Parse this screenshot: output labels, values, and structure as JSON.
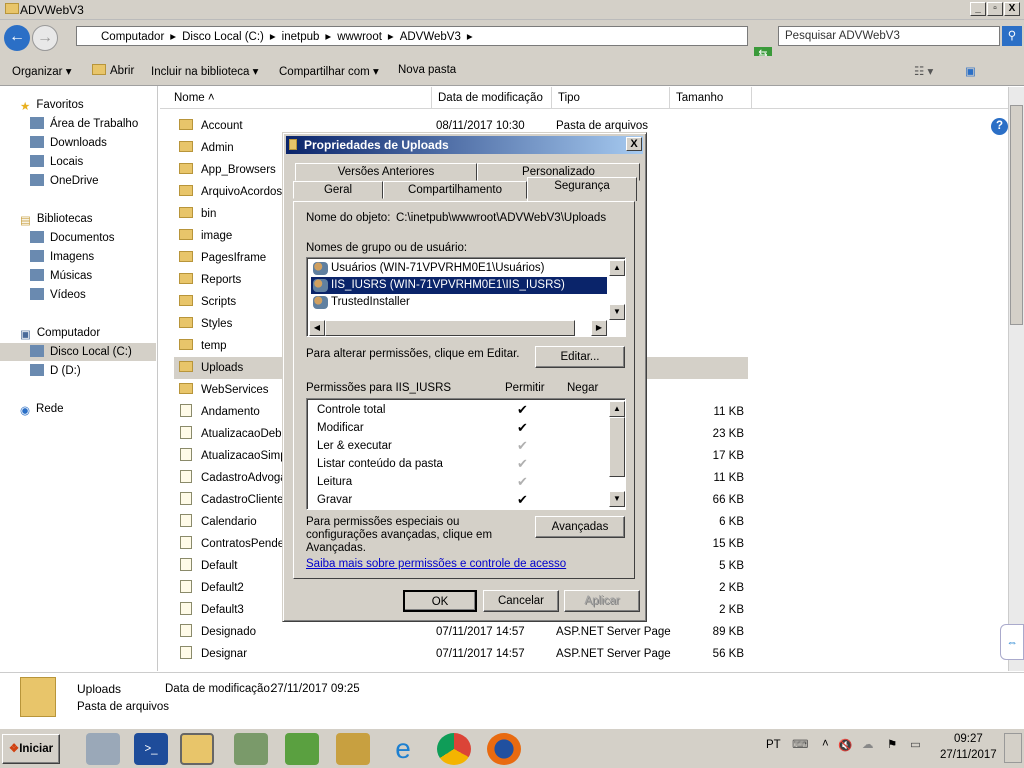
{
  "window": {
    "title": "ADVWebV3",
    "min": "_",
    "max": "▫",
    "close": "X"
  },
  "address": {
    "crumbs": [
      "Computador",
      "Disco Local (C:)",
      "inetpub",
      "wwwroot",
      "ADVWebV3"
    ],
    "search_placeholder": "Pesquisar ADVWebV3"
  },
  "toolbar": {
    "organize": "Organizar",
    "open": "Abrir",
    "include": "Incluir na biblioteca",
    "share": "Compartilhar com",
    "new_folder": "Nova pasta"
  },
  "sidebar": {
    "favorites": "Favoritos",
    "fav_items": [
      "Área de Trabalho",
      "Downloads",
      "Locais",
      "OneDrive"
    ],
    "libraries": "Bibliotecas",
    "lib_items": [
      "Documentos",
      "Imagens",
      "Músicas",
      "Vídeos"
    ],
    "computer": "Computador",
    "comp_items": [
      "Disco Local (C:)",
      "D (D:)"
    ],
    "network": "Rede"
  },
  "columns": {
    "name": "Nome",
    "date": "Data de modificação",
    "type": "Tipo",
    "size": "Tamanho"
  },
  "files": [
    {
      "name": "Account",
      "date": "08/11/2017 10:30",
      "type": "Pasta de arquivos",
      "size": "",
      "kind": "folder"
    },
    {
      "name": "Admin",
      "kind": "folder"
    },
    {
      "name": "App_Browsers",
      "kind": "folder"
    },
    {
      "name": "ArquivoAcordos",
      "kind": "folder"
    },
    {
      "name": "bin",
      "kind": "folder"
    },
    {
      "name": "image",
      "kind": "folder"
    },
    {
      "name": "PagesIframe",
      "kind": "folder"
    },
    {
      "name": "Reports",
      "kind": "folder"
    },
    {
      "name": "Scripts",
      "kind": "folder"
    },
    {
      "name": "Styles",
      "kind": "folder"
    },
    {
      "name": "temp",
      "kind": "folder"
    },
    {
      "name": "Uploads",
      "kind": "folder",
      "selected": true
    },
    {
      "name": "WebServices",
      "kind": "folder"
    },
    {
      "name": "Andamento",
      "type": "ge",
      "size": "11 KB",
      "kind": "page"
    },
    {
      "name": "AtualizacaoDebito",
      "type": "ge",
      "size": "23 KB",
      "kind": "page"
    },
    {
      "name": "AtualizacaoSimple",
      "type": "ge",
      "size": "17 KB",
      "kind": "page"
    },
    {
      "name": "CadastroAdvogac",
      "type": "ge",
      "size": "11 KB",
      "kind": "page"
    },
    {
      "name": "CadastroClientes",
      "type": "ge",
      "size": "66 KB",
      "kind": "page"
    },
    {
      "name": "Calendario",
      "type": "ge",
      "size": "6 KB",
      "kind": "page"
    },
    {
      "name": "ContratosPenden",
      "type": "ge",
      "size": "15 KB",
      "kind": "page"
    },
    {
      "name": "Default",
      "type": "ge",
      "size": "5 KB",
      "kind": "page"
    },
    {
      "name": "Default2",
      "type": "ge",
      "size": "2 KB",
      "kind": "page"
    },
    {
      "name": "Default3",
      "type": "ge",
      "size": "2 KB",
      "kind": "page"
    },
    {
      "name": "Designado",
      "date": "07/11/2017 14:57",
      "type": "ASP.NET Server Page",
      "size": "89 KB",
      "kind": "page"
    },
    {
      "name": "Designar",
      "date": "07/11/2017 14:57",
      "type": "ASP.NET Server Page",
      "size": "56 KB",
      "kind": "page"
    }
  ],
  "details": {
    "name": "Uploads",
    "modified_label": "Data de modificação:",
    "modified": "27/11/2017 09:25",
    "type": "Pasta de arquivos"
  },
  "dialog": {
    "title": "Propriedades de Uploads",
    "tabs_back": [
      "Versões Anteriores",
      "Personalizado"
    ],
    "tabs_front": [
      "Geral",
      "Compartilhamento",
      "Segurança"
    ],
    "active_tab": "Segurança",
    "object_label": "Nome do objeto:",
    "object_value": "C:\\inetpub\\wwwroot\\ADVWebV3\\Uploads",
    "groups_label": "Nomes de grupo ou de usuário:",
    "groups": [
      "Usuários (WIN-71VPVRHM0E1\\Usuários)",
      "IIS_IUSRS (WIN-71VPVRHM0E1\\IIS_IUSRS)",
      "TrustedInstaller"
    ],
    "selected_group": 1,
    "edit_hint": "Para alterar permissões, clique em Editar.",
    "edit": "Editar...",
    "perm_label": "Permissões para IIS_IUSRS",
    "allow": "Permitir",
    "deny": "Negar",
    "permissions": [
      {
        "name": "Controle total",
        "allow": "explicit"
      },
      {
        "name": "Modificar",
        "allow": "explicit"
      },
      {
        "name": "Ler & executar",
        "allow": "inherited"
      },
      {
        "name": "Listar conteúdo da pasta",
        "allow": "inherited"
      },
      {
        "name": "Leitura",
        "allow": "inherited"
      },
      {
        "name": "Gravar",
        "allow": "explicit"
      }
    ],
    "check": "✔",
    "advanced_hint": "Para permissões especiais ou configurações avançadas, clique em Avançadas.",
    "advanced": "Avançadas",
    "link": "Saiba mais sobre permissões e controle de acesso",
    "ok": "OK",
    "cancel": "Cancelar",
    "apply": "Aplicar"
  },
  "taskbar": {
    "start": "Iniciar",
    "lang": "PT",
    "time": "09:27",
    "date": "27/11/2017"
  },
  "colors": {
    "selection": "#0a246a",
    "link": "#0000cc",
    "face": "#d4d0c8"
  }
}
